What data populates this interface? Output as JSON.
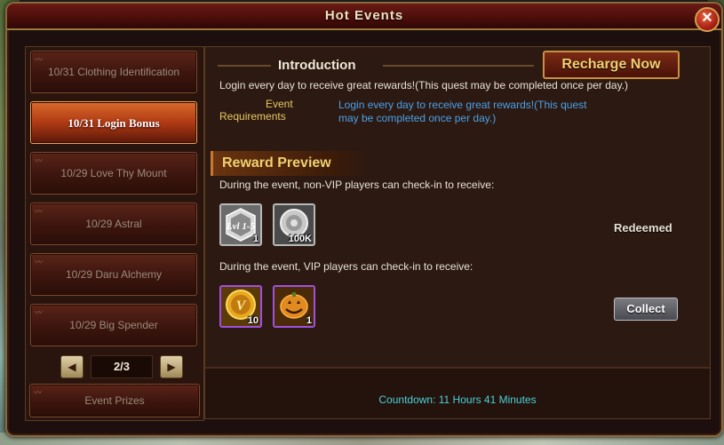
{
  "window": {
    "title": "Hot Events",
    "close_label": "✕"
  },
  "sidebar": {
    "items": [
      {
        "label": "10/31 Clothing Identification",
        "active": false
      },
      {
        "label": "10/31 Login Bonus",
        "active": true
      },
      {
        "label": "10/29 Love Thy Mount",
        "active": false
      },
      {
        "label": "10/29 Astral",
        "active": false
      },
      {
        "label": "10/29 Daru Alchemy",
        "active": false
      },
      {
        "label": "10/29 Big Spender",
        "active": false
      }
    ],
    "pager": {
      "page": "2/3",
      "prev_icon": "◀",
      "next_icon": "▶"
    },
    "prizes_label": "Event Prizes"
  },
  "main": {
    "introduction_title": "Introduction",
    "recharge_label": "Recharge Now",
    "intro_text": "Login every day to receive great rewards!(This quest may be completed once per day.)",
    "requirements_label_1": "Event",
    "requirements_label_2": "Requirements",
    "requirements_text_1": "Login every day to receive great rewards!(This quest",
    "requirements_text_2": "may be completed once per day.)",
    "reward_title": "Reward Preview",
    "nonvip_text": "During the event, non-VIP players can check-in to receive:",
    "nonvip_rewards": [
      {
        "icon": "level-badge-icon",
        "badge": "Lvl 1-5",
        "qty": "1"
      },
      {
        "icon": "silver-coin-icon",
        "qty": "100K"
      }
    ],
    "nonvip_status": "Redeemed",
    "vip_text": "During the event, VIP players can check-in to receive:",
    "vip_rewards": [
      {
        "icon": "vip-coin-icon",
        "qty": "10"
      },
      {
        "icon": "pumpkin-icon",
        "qty": "1"
      }
    ],
    "collect_label": "Collect",
    "countdown": "Countdown: 11 Hours 41 Minutes"
  }
}
